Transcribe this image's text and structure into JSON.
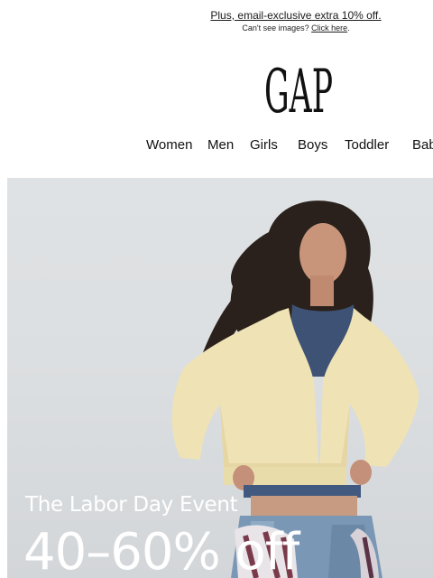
{
  "preheader": {
    "promo_text": "Plus, email-exclusive extra 10% off.",
    "cant_see_text": "Can't see images?",
    "click_here_text": "Click here",
    "period": "."
  },
  "brand": {
    "logo_text": "GAP"
  },
  "nav": {
    "items": [
      "Women",
      "Men",
      "Girls",
      "Boys",
      "Toddler",
      "Baby"
    ]
  },
  "hero": {
    "eyebrow": "The Labor Day Event",
    "headline": "40–60% off",
    "image_alt": "Model wearing yellow cropped zip hoodie and jeans"
  }
}
